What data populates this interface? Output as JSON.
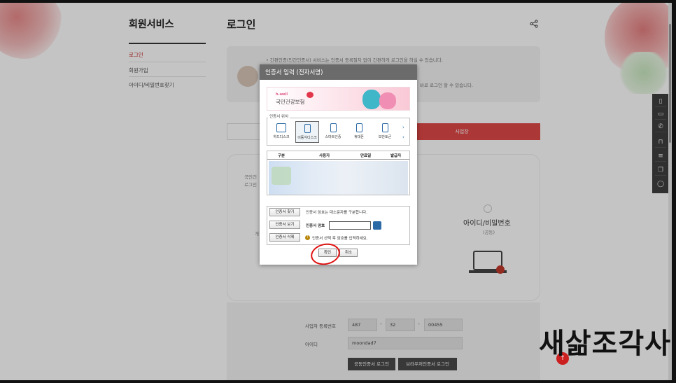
{
  "sidebar": {
    "title": "회원서비스",
    "items": [
      {
        "label": "로그인",
        "active": true
      },
      {
        "label": "회원가입",
        "active": false
      },
      {
        "label": "아이디/비밀번호찾기",
        "active": false
      }
    ]
  },
  "page": {
    "title": "로그인",
    "notice_lines": [
      "• 간편인증(민간인증서) 서비스는 인증서 등록절차 없이 간편하게 로그인을 하실 수 있습니다.",
      "바로 로그인 할 수 있습니다."
    ],
    "tab_active_label": "사업장",
    "card_text_1": "국민건",
    "card_text_2": "로그인",
    "card_side": "개",
    "card_id_pw_title": "아이디/비밀번호",
    "card_id_pw_sub": "(공동)"
  },
  "form": {
    "biz_no_label": "사업자 등록번호",
    "biz_no_1": "487",
    "biz_no_2": "32",
    "biz_no_3": "00455",
    "id_label": "아이디",
    "id_value": "moondad7",
    "cert_login_button": "공동인증서 로그인",
    "browser_cert_login_button": "브라우저인증서 로그인"
  },
  "modal": {
    "title": "인증서 입력 (전자서명)",
    "banner_small": "h-well",
    "banner_main": "국민건강보험",
    "location_label": "인증서 위치",
    "devices": [
      {
        "label": "하드디스크",
        "selected": false
      },
      {
        "label": "이동식디스크",
        "selected": true
      },
      {
        "label": "스마트인증",
        "selected": false
      },
      {
        "label": "휴대폰",
        "selected": false
      },
      {
        "label": "보안토큰",
        "selected": false
      }
    ],
    "table_headers": [
      "구분",
      "사용자",
      "만료일",
      "발급자"
    ],
    "find_button": "인증서 찾기",
    "view_button": "인증서 보기",
    "delete_button": "인증서 삭제",
    "case_note": "인증서 암호는 대소문자를 구분합니다.",
    "password_label": "인증서 암호",
    "select_note": "인증서 선택 후 암호를 입력하세요.",
    "ok_button": "확인",
    "cancel_button": "취소"
  },
  "watermark": "새삶조각사",
  "colors": {
    "accent": "#e04848",
    "annotation": "#e01010",
    "modal_header": "#6b6b6b"
  }
}
